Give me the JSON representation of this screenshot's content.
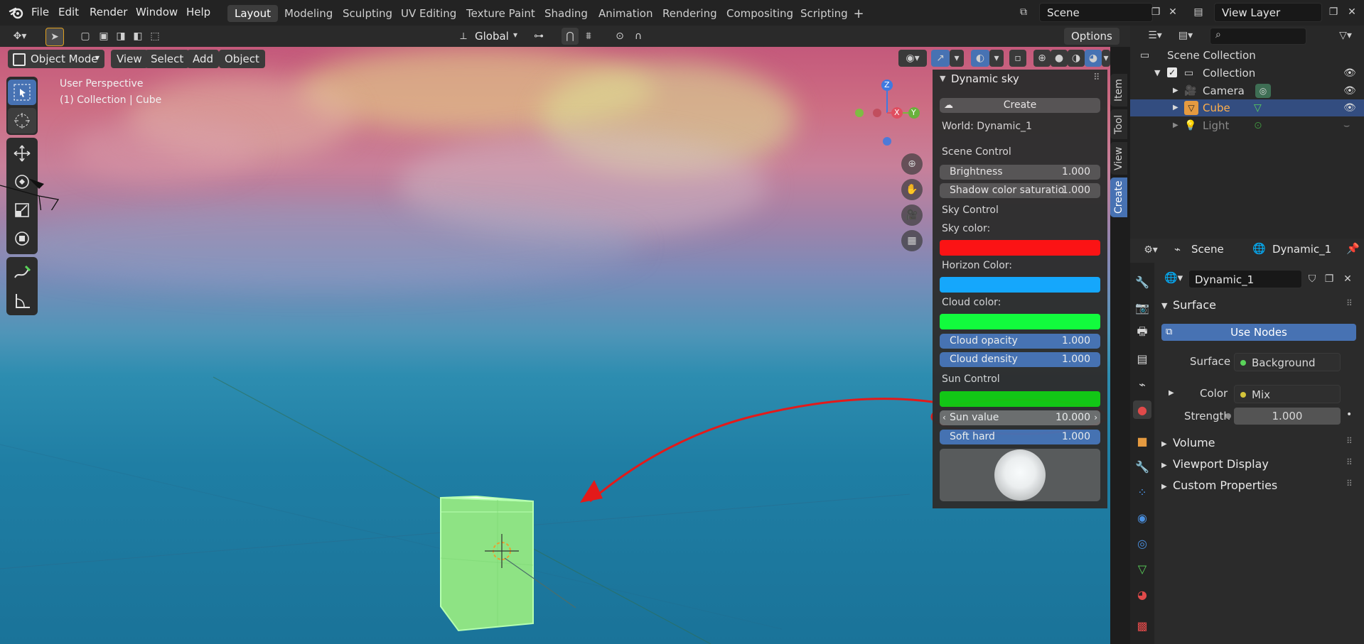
{
  "menu": {
    "file": "File",
    "edit": "Edit",
    "render": "Render",
    "window": "Window",
    "help": "Help"
  },
  "workspaces": [
    "Layout",
    "Modeling",
    "Sculpting",
    "UV Editing",
    "Texture Paint",
    "Shading",
    "Animation",
    "Rendering",
    "Compositing",
    "Scripting"
  ],
  "active_workspace": "Layout",
  "scene_field": "Scene",
  "view_layer_field": "View Layer",
  "toolbar": {
    "transform_orientation": "Global",
    "options": "Options"
  },
  "viewport_header": {
    "mode": "Object Mode",
    "view": "View",
    "select": "Select",
    "add": "Add",
    "object": "Object"
  },
  "viewport_info": {
    "perspective": "User Perspective",
    "collection": "(1) Collection | Cube"
  },
  "gizmo": {
    "z": "Z",
    "x": "X",
    "y": "Y"
  },
  "npanel": {
    "title": "Dynamic sky",
    "create_button": "Create",
    "world": "World: Dynamic_1",
    "scene_control": "Scene Control",
    "brightness_label": "Brightness",
    "brightness_value": "1.000",
    "shadow_label": "Shadow color saturatio",
    "shadow_value": "1.000",
    "sky_control": "Sky Control",
    "sky_color_label": "Sky color:",
    "horizon_color_label": "Horizon Color:",
    "cloud_color_label": "Cloud color:",
    "cloud_opacity_label": "Cloud opacity",
    "cloud_opacity_value": "1.000",
    "cloud_density_label": "Cloud density",
    "cloud_density_value": "1.000",
    "sun_control": "Sun Control",
    "sun_value_label": "Sun value",
    "sun_value_value": "10.000",
    "soft_hard_label": "Soft hard",
    "soft_hard_value": "1.000",
    "sky_color": "#ff1010",
    "horizon_color": "#12a8ff",
    "cloud_color": "#10ff3a",
    "sun_color": "#12c812"
  },
  "side_tabs": [
    "Item",
    "Tool",
    "View",
    "Create"
  ],
  "active_side_tab": "Create",
  "outliner": {
    "search_placeholder": "",
    "scene_collection": "Scene Collection",
    "collection": "Collection",
    "camera": "Camera",
    "cube": "Cube",
    "light": "Light"
  },
  "properties": {
    "scene": "Scene",
    "world": "Dynamic_1",
    "world_field": "Dynamic_1",
    "surface_panel": "Surface",
    "use_nodes": "Use Nodes",
    "surface_label": "Surface",
    "surface_value": "Background",
    "color_label": "Color",
    "color_value": "Mix",
    "strength_label": "Strength",
    "strength_value": "1.000",
    "volume_panel": "Volume",
    "viewport_display_panel": "Viewport Display",
    "custom_properties_panel": "Custom Properties"
  }
}
